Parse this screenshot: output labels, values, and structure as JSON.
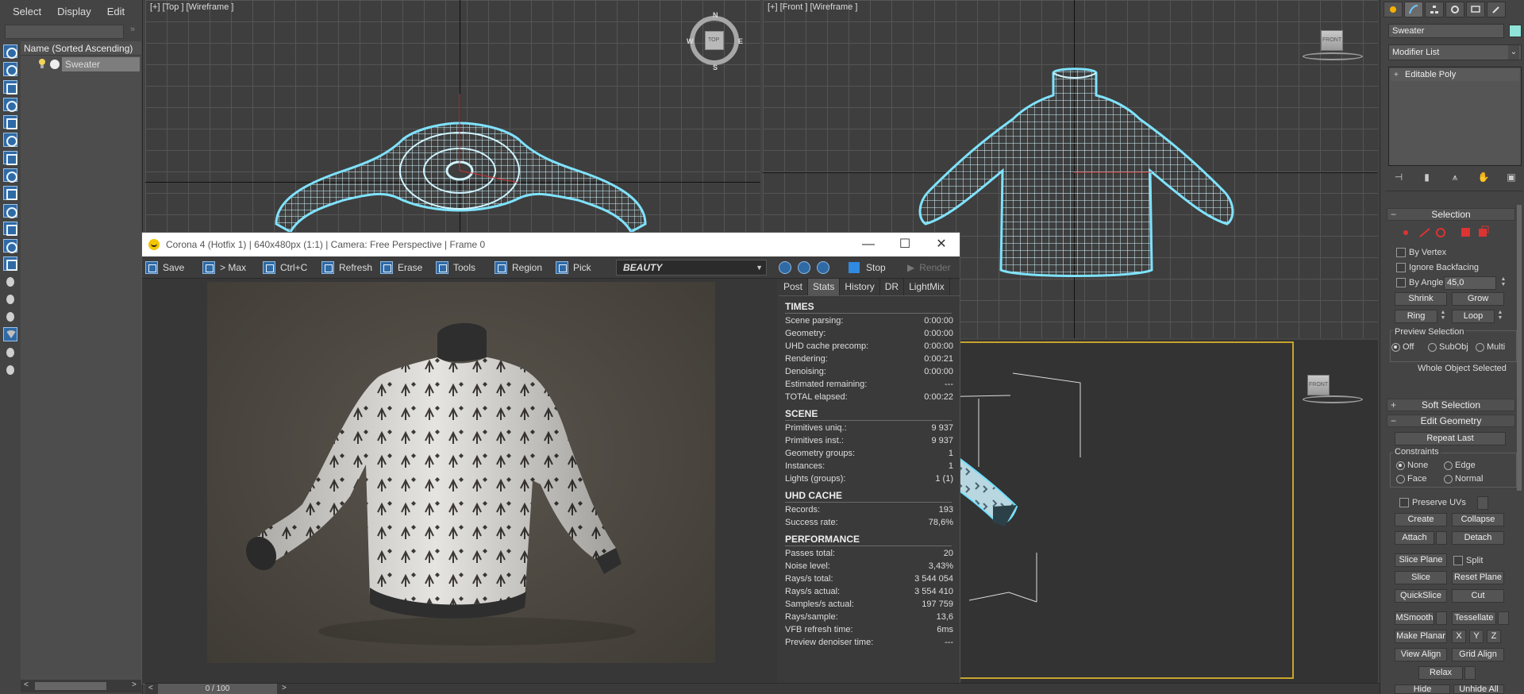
{
  "explorer": {
    "menu": [
      "Select",
      "Display",
      "Edit"
    ],
    "column_header": "Name (Sorted Ascending)",
    "object_name": "Sweater",
    "scroll_left": "<",
    "scroll_right": ">",
    "search_arrow": "»"
  },
  "viewports": {
    "top": {
      "label": "[+] [Top ] [Wireframe ]",
      "compass": {
        "n": "N",
        "s": "S",
        "e": "E",
        "w": "W",
        "cube": "TOP"
      }
    },
    "front": {
      "label": "[+] [Front ] [Wireframe ]",
      "cube": "FRONT"
    },
    "perspective": {
      "cube": "FRONT"
    }
  },
  "vfb": {
    "title": "Corona 4 (Hotfix 1) | 640x480px (1:1) | Camera: Free Perspective | Frame 0",
    "window_buttons": {
      "minimize": "—",
      "maximize": "☐",
      "close": "✕"
    },
    "toolbar": {
      "save": "Save",
      "to_max": "> Max",
      "copy": "Ctrl+C",
      "refresh": "Refresh",
      "erase": "Erase",
      "tools": "Tools",
      "region": "Region",
      "pick": "Pick",
      "render_element": "BEAUTY",
      "stop": "Stop",
      "render": "Render"
    },
    "stats": {
      "tabs": [
        "Post",
        "Stats",
        "History",
        "DR",
        "LightMix"
      ],
      "active_tab": "Stats",
      "sections": [
        {
          "title": "TIMES",
          "rows": [
            {
              "k": "Scene parsing:",
              "v": "0:00:00"
            },
            {
              "k": "Geometry:",
              "v": "0:00:00"
            },
            {
              "k": "UHD cache precomp:",
              "v": "0:00:00"
            },
            {
              "k": "Rendering:",
              "v": "0:00:21"
            },
            {
              "k": "Denoising:",
              "v": "0:00:00"
            },
            {
              "k": "Estimated remaining:",
              "v": "---"
            },
            {
              "k": "TOTAL elapsed:",
              "v": "0:00:22"
            }
          ]
        },
        {
          "title": "SCENE",
          "rows": [
            {
              "k": "Primitives uniq.:",
              "v": "9 937"
            },
            {
              "k": "Primitives inst.:",
              "v": "9 937"
            },
            {
              "k": "Geometry groups:",
              "v": "1"
            },
            {
              "k": "Instances:",
              "v": "1"
            },
            {
              "k": "Lights (groups):",
              "v": "1 (1)"
            }
          ]
        },
        {
          "title": "UHD CACHE",
          "rows": [
            {
              "k": "Records:",
              "v": "193"
            },
            {
              "k": "Success rate:",
              "v": "78,6%"
            }
          ]
        },
        {
          "title": "PERFORMANCE",
          "rows": [
            {
              "k": "Passes total:",
              "v": "20"
            },
            {
              "k": "Noise level:",
              "v": "3,43%"
            },
            {
              "k": "Rays/s total:",
              "v": "3 544 054"
            },
            {
              "k": "Rays/s actual:",
              "v": "3 554 410"
            },
            {
              "k": "Samples/s actual:",
              "v": "197 759"
            },
            {
              "k": "Rays/sample:",
              "v": "13,6"
            },
            {
              "k": "VFB refresh time:",
              "v": "6ms"
            },
            {
              "k": "Preview denoiser time:",
              "v": "---"
            }
          ]
        }
      ]
    }
  },
  "command_panel": {
    "object_name": "Sweater",
    "object_color": "#8fe3d8",
    "modifier_list": "Modifier List",
    "modifier_list_arrow": "⌄",
    "stack": [
      "Editable Poly"
    ],
    "selection": {
      "title": "Selection",
      "by_vertex": "By Vertex",
      "ignore_backfacing": "Ignore Backfacing",
      "by_angle": "By Angle:",
      "angle_value": "45,0",
      "shrink": "Shrink",
      "grow": "Grow",
      "ring": "Ring",
      "loop": "Loop",
      "preview_selection": "Preview Selection",
      "preview_off": "Off",
      "preview_subobj": "SubObj",
      "preview_multi": "Multi",
      "status": "Whole Object Selected"
    },
    "soft_selection": "Soft Selection",
    "edit_geometry": {
      "title": "Edit Geometry",
      "repeat_last": "Repeat Last",
      "constraints": "Constraints",
      "none": "None",
      "edge": "Edge",
      "face": "Face",
      "normal": "Normal",
      "preserve_uvs": "Preserve UVs",
      "create": "Create",
      "collapse": "Collapse",
      "attach": "Attach",
      "detach": "Detach",
      "slice_plane": "Slice Plane",
      "split": "Split",
      "slice": "Slice",
      "reset_plane": "Reset Plane",
      "quickslice": "QuickSlice",
      "cut": "Cut",
      "msmooth": "MSmooth",
      "tessellate": "Tessellate",
      "make_planar": "Make Planar",
      "x": "X",
      "y": "Y",
      "z": "Z",
      "view_align": "View Align",
      "grid_align": "Grid Align",
      "relax": "Relax",
      "hide_selected": "Hide Selected",
      "unhide_all": "Unhide All"
    }
  },
  "timeslider": {
    "frame": "0 / 100",
    "prev": "<",
    "next": ">"
  }
}
